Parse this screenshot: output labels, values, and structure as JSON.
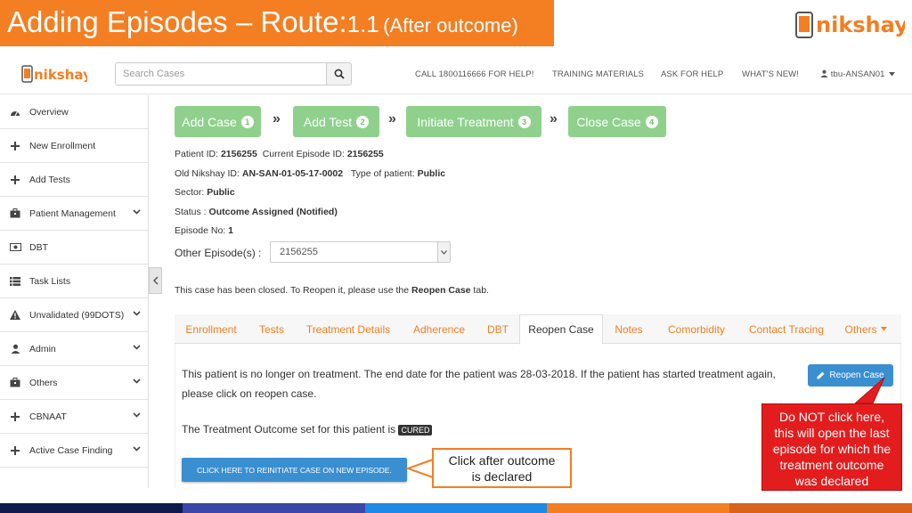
{
  "slide": {
    "title_main": "Adding Episodes – Route:",
    "title_route_num": "1.1",
    "title_paren": "(After outcome)"
  },
  "header": {
    "search_placeholder": "Search Cases",
    "nav": [
      "CALL 1800116666 FOR HELP!",
      "TRAINING MATERIALS",
      "ASK FOR HELP",
      "WHAT'S NEW!",
      "tbu-ANSAN01"
    ]
  },
  "sidebar": {
    "items": [
      {
        "label": "Overview",
        "icon": "dashboard-icon",
        "chevron": false
      },
      {
        "label": "New Enrollment",
        "icon": "plus-icon",
        "chevron": false
      },
      {
        "label": "Add Tests",
        "icon": "plus-icon",
        "chevron": false
      },
      {
        "label": "Patient Management",
        "icon": "briefcase-icon",
        "chevron": true
      },
      {
        "label": "DBT",
        "icon": "money-icon",
        "chevron": false
      },
      {
        "label": "Task Lists",
        "icon": "list-icon",
        "chevron": false
      },
      {
        "label": "Unvalidated (99DOTS)",
        "icon": "warning-icon",
        "chevron": true
      },
      {
        "label": "Admin",
        "icon": "user-icon",
        "chevron": true
      },
      {
        "label": "Others",
        "icon": "briefcase-icon",
        "chevron": true
      },
      {
        "label": "CBNAAT",
        "icon": "plus-icon",
        "chevron": true
      },
      {
        "label": "Active Case Finding",
        "icon": "plus-icon",
        "chevron": true
      }
    ]
  },
  "steps": [
    {
      "label": "Add Case",
      "num": "1"
    },
    {
      "label": "Add Test",
      "num": "2"
    },
    {
      "label": "Initiate Treatment",
      "num": "3"
    },
    {
      "label": "Close Case",
      "num": "4"
    }
  ],
  "patient": {
    "patient_id_label": "Patient ID:",
    "patient_id": "2156255",
    "current_episode_label": "Current Episode ID:",
    "current_episode": "2156255",
    "old_id_label": "Old Nikshay ID:",
    "old_id": "AN-SAN-01-05-17-0002",
    "type_label": "Type of patient:",
    "type": "Public",
    "sector_label": "Sector:",
    "sector": "Public",
    "status_label": "Status :",
    "status": "Outcome Assigned (Notified)",
    "episode_no_label": "Episode No:",
    "episode_no": "1",
    "other_episodes_label": "Other Episode(s) :",
    "other_episodes_value": "2156255"
  },
  "closed_note": {
    "prefix": "This case has been closed. To Reopen it, please use the ",
    "bold": "Reopen Case",
    "suffix": " tab."
  },
  "tabs": [
    {
      "label": "Enrollment",
      "active": false
    },
    {
      "label": "Tests",
      "active": false
    },
    {
      "label": "Treatment Details",
      "active": false
    },
    {
      "label": "Adherence",
      "active": false
    },
    {
      "label": "DBT",
      "active": false
    },
    {
      "label": "Reopen Case",
      "active": true
    },
    {
      "label": "Notes",
      "active": false
    },
    {
      "label": "Comorbidity",
      "active": false
    },
    {
      "label": "Contact Tracing",
      "active": false
    },
    {
      "label": "Others",
      "active": false
    }
  ],
  "panel": {
    "line1": "This patient is no longer on treatment. The end date for the patient was 28-03-2018. If the patient has started treatment again,",
    "line2": "please click on reopen case.",
    "outcome_text": "The Treatment Outcome set for this patient is",
    "outcome_badge": "CURED",
    "reopen_button": "Reopen Case",
    "reinit_button": "CLICK HERE TO REINITIATE CASE ON NEW EPISODE."
  },
  "callouts": {
    "orange_line1": "Click after outcome",
    "orange_line2": "is declared",
    "red_lines": [
      "Do NOT click here,",
      "this will open the last",
      "episode for which the",
      "treatment outcome",
      "was declared"
    ]
  },
  "colors": {
    "orange": "#f47e22",
    "step_green": "#8fd18c",
    "button_blue": "#3a8fd1",
    "callout_red": "#e31d1d",
    "bottom_bar": [
      "#0f1a4a",
      "#3b46a6",
      "#1e88e5",
      "#f47e22",
      "#d9621c"
    ]
  }
}
